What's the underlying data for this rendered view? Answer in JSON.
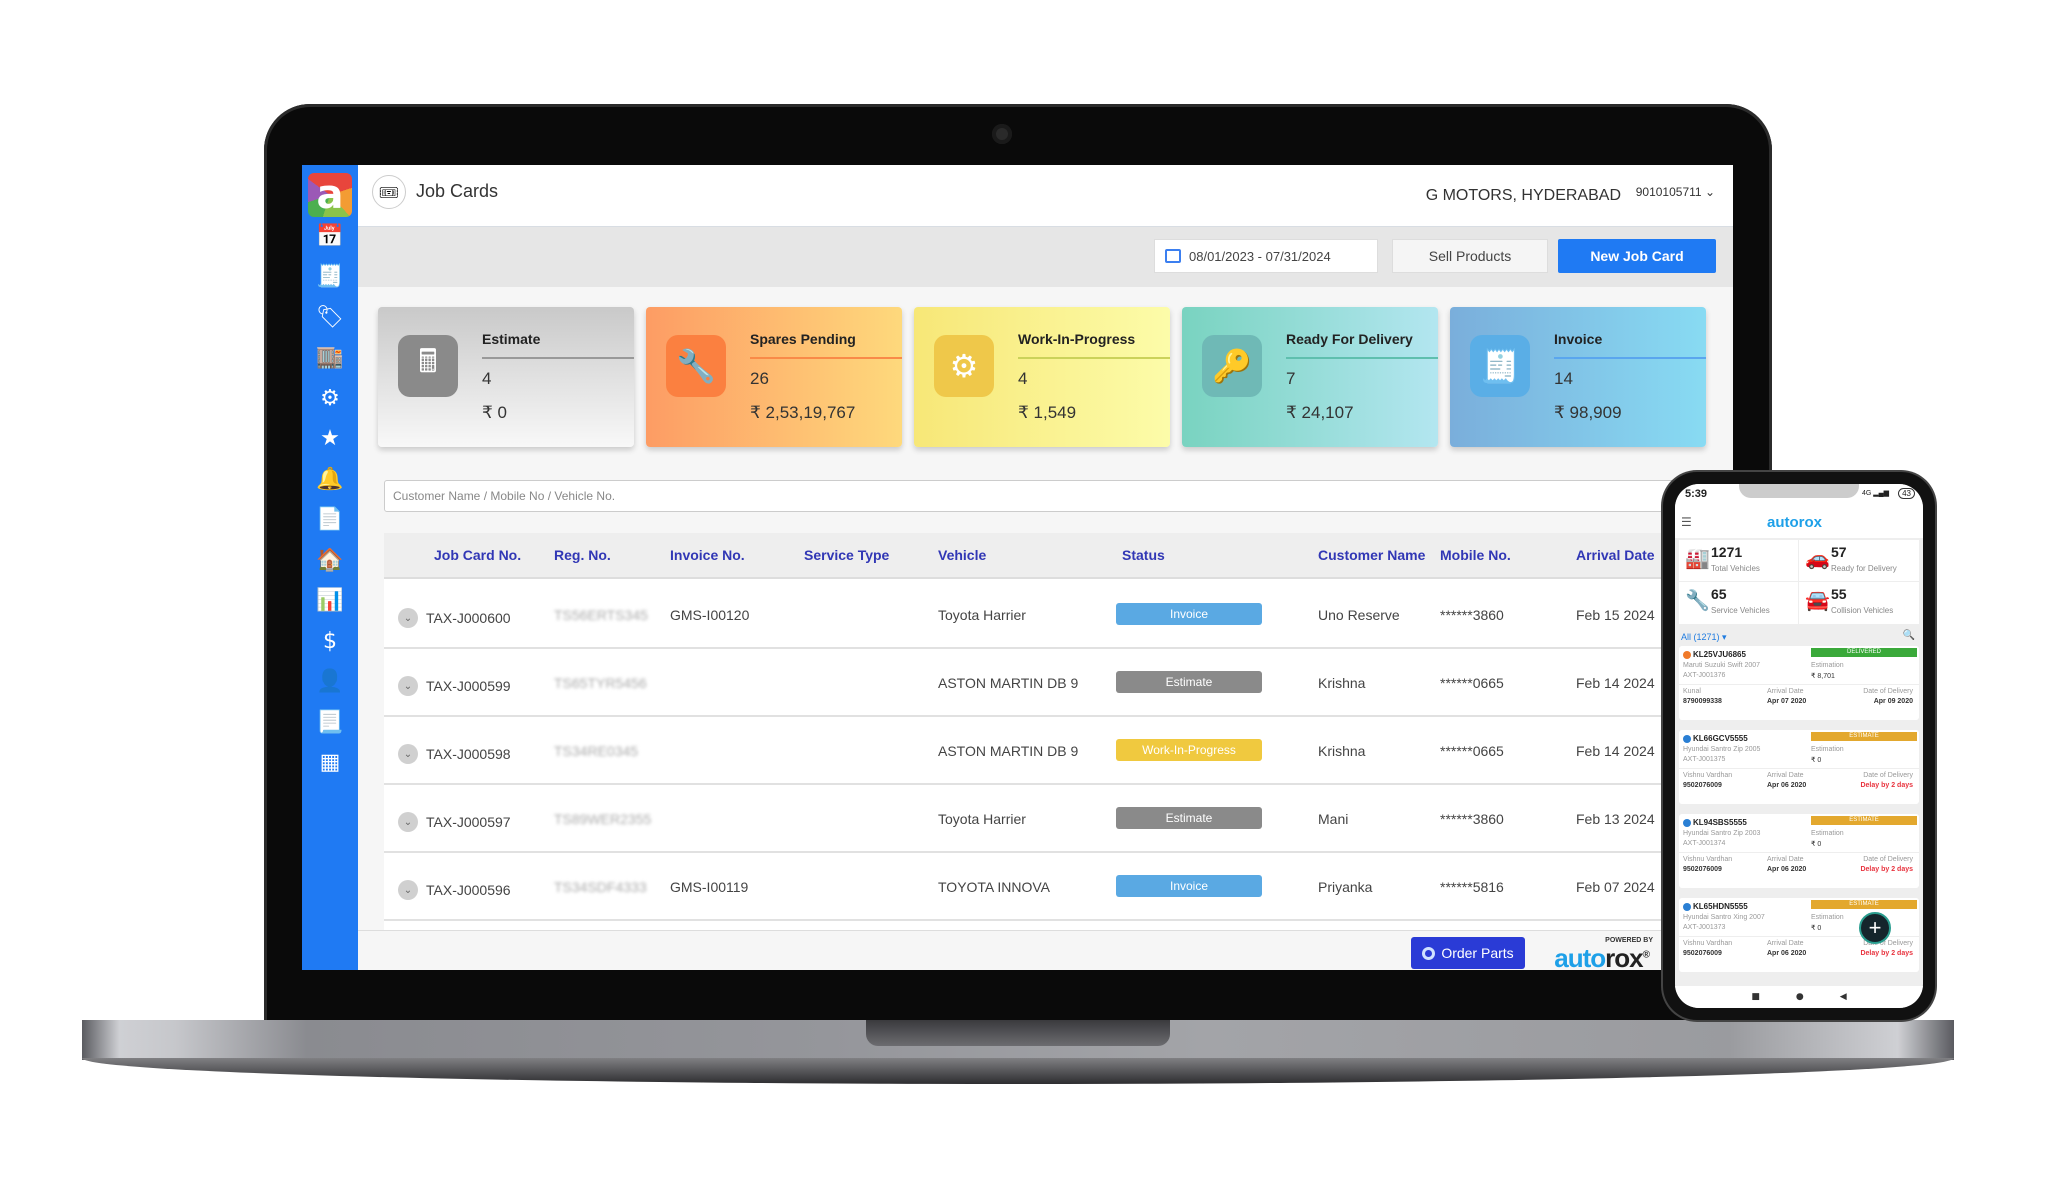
{
  "app": {
    "page_title": "Job Cards",
    "company": "G MOTORS, HYDERABAD",
    "phone": "9010105711",
    "phone_chevron": "⌄"
  },
  "toolbar": {
    "date_range": "08/01/2023 - 07/31/2024",
    "sell_products_label": "Sell Products",
    "new_job_card_label": "New Job Card"
  },
  "sidebar": {
    "items": [
      {
        "name": "calendar-icon",
        "glyph": "📅"
      },
      {
        "name": "invoice-scroll-icon",
        "glyph": "🧾"
      },
      {
        "name": "tags-icon",
        "glyph": "🏷"
      },
      {
        "name": "warehouse-icon",
        "glyph": "🏬"
      },
      {
        "name": "belt-icon",
        "glyph": "⚙"
      },
      {
        "name": "rating-icon",
        "glyph": "★"
      },
      {
        "name": "bell-icon",
        "glyph": "🔔"
      },
      {
        "name": "document-dollar-icon",
        "glyph": "📄"
      },
      {
        "name": "garage-icon",
        "glyph": "🏠"
      },
      {
        "name": "report-chart-icon",
        "glyph": "📊"
      },
      {
        "name": "revenue-icon",
        "glyph": "$"
      },
      {
        "name": "user-icon",
        "glyph": "👤"
      },
      {
        "name": "billing-icon",
        "glyph": "📃"
      },
      {
        "name": "table-icon",
        "glyph": "▦"
      }
    ]
  },
  "cards": [
    {
      "label": "Estimate",
      "count": "4",
      "amount": "₹ 0",
      "glyph": "🖩",
      "bg": "linear-gradient(180deg,#c9c9c9,#f8f8f8)",
      "icon_bg": "#8a8a8a",
      "line": "#999999"
    },
    {
      "label": "Spares Pending",
      "count": "26",
      "amount": "₹ 2,53,19,767",
      "glyph": "🔧",
      "bg": "linear-gradient(90deg,#fd9c64,#fed97c)",
      "icon_bg": "#fb8040",
      "line": "#f98a48"
    },
    {
      "label": "Work-In-Progress",
      "count": "4",
      "amount": "₹ 1,549",
      "glyph": "⚙",
      "bg": "linear-gradient(90deg,#f7e777,#fcfca9)",
      "icon_bg": "#efc84a",
      "line": "#cbd25a"
    },
    {
      "label": "Ready For Delivery",
      "count": "7",
      "amount": "₹ 24,107",
      "glyph": "🔑",
      "bg": "linear-gradient(90deg,#79d3c0,#b3e6f0)",
      "icon_bg": "#6fb9b6",
      "line": "#5fbfae"
    },
    {
      "label": "Invoice",
      "count": "14",
      "amount": "₹ 98,909",
      "glyph": "🧾",
      "bg": "linear-gradient(90deg,#7aaedb,#88dbf3)",
      "icon_bg": "#5aaee6",
      "line": "#5aa6ee"
    }
  ],
  "search": {
    "placeholder": "Customer Name / Mobile No / Vehicle No."
  },
  "table": {
    "headers": [
      "Job Card No.",
      "Reg. No.",
      "Invoice No.",
      "Service Type",
      "Vehicle",
      "Status",
      "Customer Name",
      "Mobile No.",
      "Arrival Date"
    ],
    "rows": [
      {
        "job": "TAX-J000600",
        "reg": "TS56ERTS345",
        "invoice": "GMS-I00120",
        "service": "",
        "vehicle": "Toyota Harrier",
        "status": "Invoice",
        "status_color": "#5aa9e3",
        "customer": "Uno Reserve",
        "mobile": "******3860",
        "arrival": "Feb 15 2024"
      },
      {
        "job": "TAX-J000599",
        "reg": "TS65TYR5456",
        "invoice": "",
        "service": "",
        "vehicle": "ASTON MARTIN DB 9",
        "status": "Estimate",
        "status_color": "#8a8a8a",
        "customer": "Krishna",
        "mobile": "******0665",
        "arrival": "Feb 14 2024"
      },
      {
        "job": "TAX-J000598",
        "reg": "TS34RE0345",
        "invoice": "",
        "service": "",
        "vehicle": "ASTON MARTIN DB 9",
        "status": "Work-In-Progress",
        "status_color": "#f0c93f",
        "customer": "Krishna",
        "mobile": "******0665",
        "arrival": "Feb 14 2024"
      },
      {
        "job": "TAX-J000597",
        "reg": "TS89WER2355",
        "invoice": "",
        "service": "",
        "vehicle": "Toyota Harrier",
        "status": "Estimate",
        "status_color": "#8a8a8a",
        "customer": "Mani",
        "mobile": "******3860",
        "arrival": "Feb 13 2024"
      },
      {
        "job": "TAX-J000596",
        "reg": "TS34SDF4333",
        "invoice": "GMS-I00119",
        "service": "",
        "vehicle": "TOYOTA INNOVA",
        "status": "Invoice",
        "status_color": "#5aa9e3",
        "customer": "Priyanka",
        "mobile": "******5816",
        "arrival": "Feb 07 2024"
      }
    ]
  },
  "footer": {
    "order_parts_label": "Order Parts",
    "powered_by": "POWERED BY",
    "brand_a": "auto",
    "brand_b": "rox",
    "registered": "®"
  },
  "phone": {
    "time": "5:39",
    "signal": "4G ▂▄▆",
    "battery": "43",
    "logo": "autorox",
    "stats": [
      {
        "value": "1271",
        "label": "Total Vehicles",
        "glyph": "🏭",
        "color": "#e85a6a"
      },
      {
        "value": "57",
        "label": "Ready for Delivery",
        "glyph": "🚗",
        "color": "#1ab5c8"
      },
      {
        "value": "65",
        "label": "Service Vehicles",
        "glyph": "🔧",
        "color": "#54b948"
      },
      {
        "value": "55",
        "label": "Collision Vehicles",
        "glyph": "🚘",
        "color": "#f0612a"
      }
    ],
    "filter": "All (1271) ▾",
    "jobs": [
      {
        "reg": "KL25VJU6865",
        "model": "Maruti Suzuki Swift 2007",
        "jc": "AXT-J001376",
        "status": "DELIVERED",
        "status_color": "#3aa93a",
        "dot": "#f07a2a",
        "est_label": "Estimation",
        "est": "₹ 8,701",
        "customer": "Kunal",
        "mobile": "8790099338",
        "arrival_label": "Arrival Date",
        "arrival": "Apr 07 2020",
        "delivery_label": "Date of Delivery",
        "delivery": "Apr 09 2020",
        "delay": false
      },
      {
        "reg": "KL66GCV5555",
        "model": "Hyundai Santro Zip 2005",
        "jc": "AXT-J001375",
        "status": "ESTIMATE",
        "status_color": "#e3a82e",
        "dot": "#2a7fd4",
        "est_label": "Estimation",
        "est": "₹ 0",
        "customer": "Vishnu Vardhan",
        "mobile": "9502076009",
        "arrival_label": "Arrival Date",
        "arrival": "Apr 06 2020",
        "delivery_label": "Date of Delivery",
        "delivery": "Delay by 2 days",
        "delay": true
      },
      {
        "reg": "KL94SBS5555",
        "model": "Hyundai Santro Zip 2003",
        "jc": "AXT-J001374",
        "status": "ESTIMATE",
        "status_color": "#e3a82e",
        "dot": "#2a7fd4",
        "est_label": "Estimation",
        "est": "₹ 0",
        "customer": "Vishnu Vardhan",
        "mobile": "9502076009",
        "arrival_label": "Arrival Date",
        "arrival": "Apr 06 2020",
        "delivery_label": "Date of Delivery",
        "delivery": "Delay by 2 days",
        "delay": true
      },
      {
        "reg": "KL65HDN5555",
        "model": "Hyundai Santro Xing 2007",
        "jc": "AXT-J001373",
        "status": "ESTIMATE",
        "status_color": "#e3a82e",
        "dot": "#2a7fd4",
        "est_label": "Estimation",
        "est": "₹ 0",
        "customer": "Vishnu Vardhan",
        "mobile": "9502076009",
        "arrival_label": "Arrival Date",
        "arrival": "Apr 06 2020",
        "delivery_label": "Date of Delivery",
        "delivery": "Delay by 2 days",
        "delay": true
      }
    ],
    "fab": "+",
    "nav": [
      "■",
      "●",
      "◀"
    ]
  }
}
